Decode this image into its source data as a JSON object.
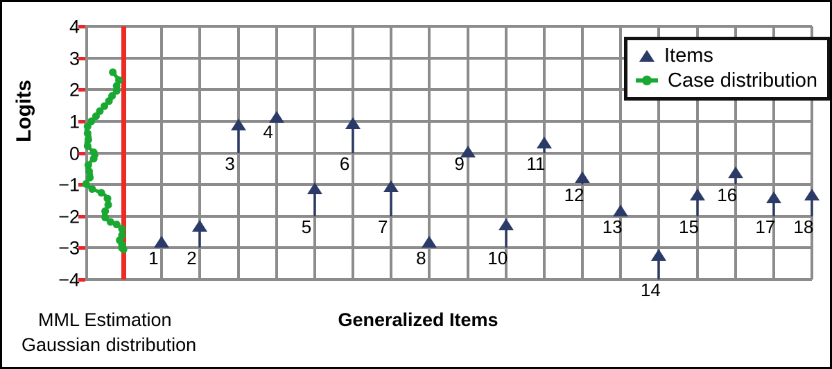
{
  "figure": {
    "border_color": "#000000",
    "background": "#ffffff"
  },
  "yaxis": {
    "title": "Logits",
    "ticks": [
      "4",
      "3",
      "2",
      "1",
      "0",
      "−1",
      "−2",
      "−3",
      "−4"
    ],
    "tick_color": "#e8272b"
  },
  "xaxis": {
    "title": "Generalized Items"
  },
  "legend": {
    "items_label": "Items",
    "case_label": "Case distribution"
  },
  "footnote": {
    "line1": "MML Estimation",
    "line2": "Gaussian distribution"
  },
  "colors": {
    "marker": "#2b3a67",
    "case_curve": "#19a832",
    "reference_line": "#ee2a24",
    "grid": "#8c8c8c"
  },
  "chart_data": {
    "type": "scatter",
    "title": "",
    "xlabel": "Generalized Items",
    "ylabel": "Logits",
    "ylim": [
      -4,
      4
    ],
    "xlim": [
      0,
      19
    ],
    "grid": true,
    "legend_position": "top-right",
    "annotations": [
      "MML Estimation",
      "Gaussian distribution"
    ],
    "reference_line": {
      "orientation": "vertical",
      "x": 1.0,
      "color": "#ee2a24"
    },
    "series": [
      {
        "name": "Items",
        "type": "scatter",
        "marker": "triangle-up",
        "color": "#2b3a67",
        "labels": [
          "1",
          "2",
          "3",
          "4",
          "5",
          "6",
          "7",
          "8",
          "9",
          "10",
          "11",
          "12",
          "13",
          "14",
          "15",
          "16",
          "17",
          "18"
        ],
        "x": [
          2,
          3,
          4,
          5,
          6,
          7,
          8,
          9,
          10,
          11,
          12,
          13,
          14,
          15,
          16,
          17,
          18,
          19
        ],
        "values": [
          -2.8,
          -2.3,
          0.9,
          1.15,
          -1.1,
          0.95,
          -1.05,
          -2.8,
          0.05,
          -2.25,
          0.35,
          -0.75,
          -1.8,
          -3.2,
          -1.3,
          -0.6,
          -1.4,
          -1.3
        ]
      },
      {
        "name": "Case distribution",
        "type": "line",
        "marker": "circle",
        "color": "#19a832",
        "x": [
          0.72,
          0.82,
          0.88,
          0.86,
          0.82,
          0.86,
          0.82,
          0.75,
          0.7,
          0.68,
          0.62,
          0.56,
          0.5,
          0.44,
          0.38,
          0.32,
          0.28,
          0.22,
          0.16,
          0.1,
          0.06,
          0.02,
          0.06,
          0.12,
          0.08,
          0.02,
          0.06,
          0.14,
          0.22,
          0.3,
          0.22,
          0.14,
          0.08,
          0.04,
          0.1,
          0.16,
          0.12,
          0.06,
          0.02,
          0.08,
          0.18,
          0.3,
          0.42,
          0.52,
          0.58,
          0.62,
          0.6,
          0.56,
          0.52,
          0.48,
          0.52,
          0.58,
          0.66,
          0.74,
          0.82,
          0.9,
          0.96,
          0.98,
          0.96,
          0.92,
          0.9,
          0.94,
          0.96,
          0.98,
          0.96,
          0.98,
          1.0
        ],
        "values": [
          2.55,
          2.4,
          2.3,
          2.22,
          2.12,
          2.05,
          1.96,
          1.88,
          1.8,
          1.72,
          1.64,
          1.56,
          1.48,
          1.4,
          1.32,
          1.24,
          1.16,
          1.08,
          1.0,
          0.92,
          0.84,
          0.72,
          0.62,
          0.52,
          0.42,
          0.32,
          0.22,
          0.12,
          0.02,
          -0.08,
          -0.18,
          -0.28,
          -0.38,
          -0.48,
          -0.58,
          -0.68,
          -0.78,
          -0.88,
          -0.98,
          -1.06,
          -1.14,
          -1.2,
          -1.26,
          -1.34,
          -1.44,
          -1.54,
          -1.64,
          -1.74,
          -1.84,
          -1.94,
          -2.04,
          -2.12,
          -2.18,
          -2.22,
          -2.26,
          -2.32,
          -2.4,
          -2.5,
          -2.6,
          -2.68,
          -2.76,
          -2.84,
          -2.9,
          -2.95,
          -3.0,
          -3.03,
          -3.05
        ]
      }
    ]
  }
}
